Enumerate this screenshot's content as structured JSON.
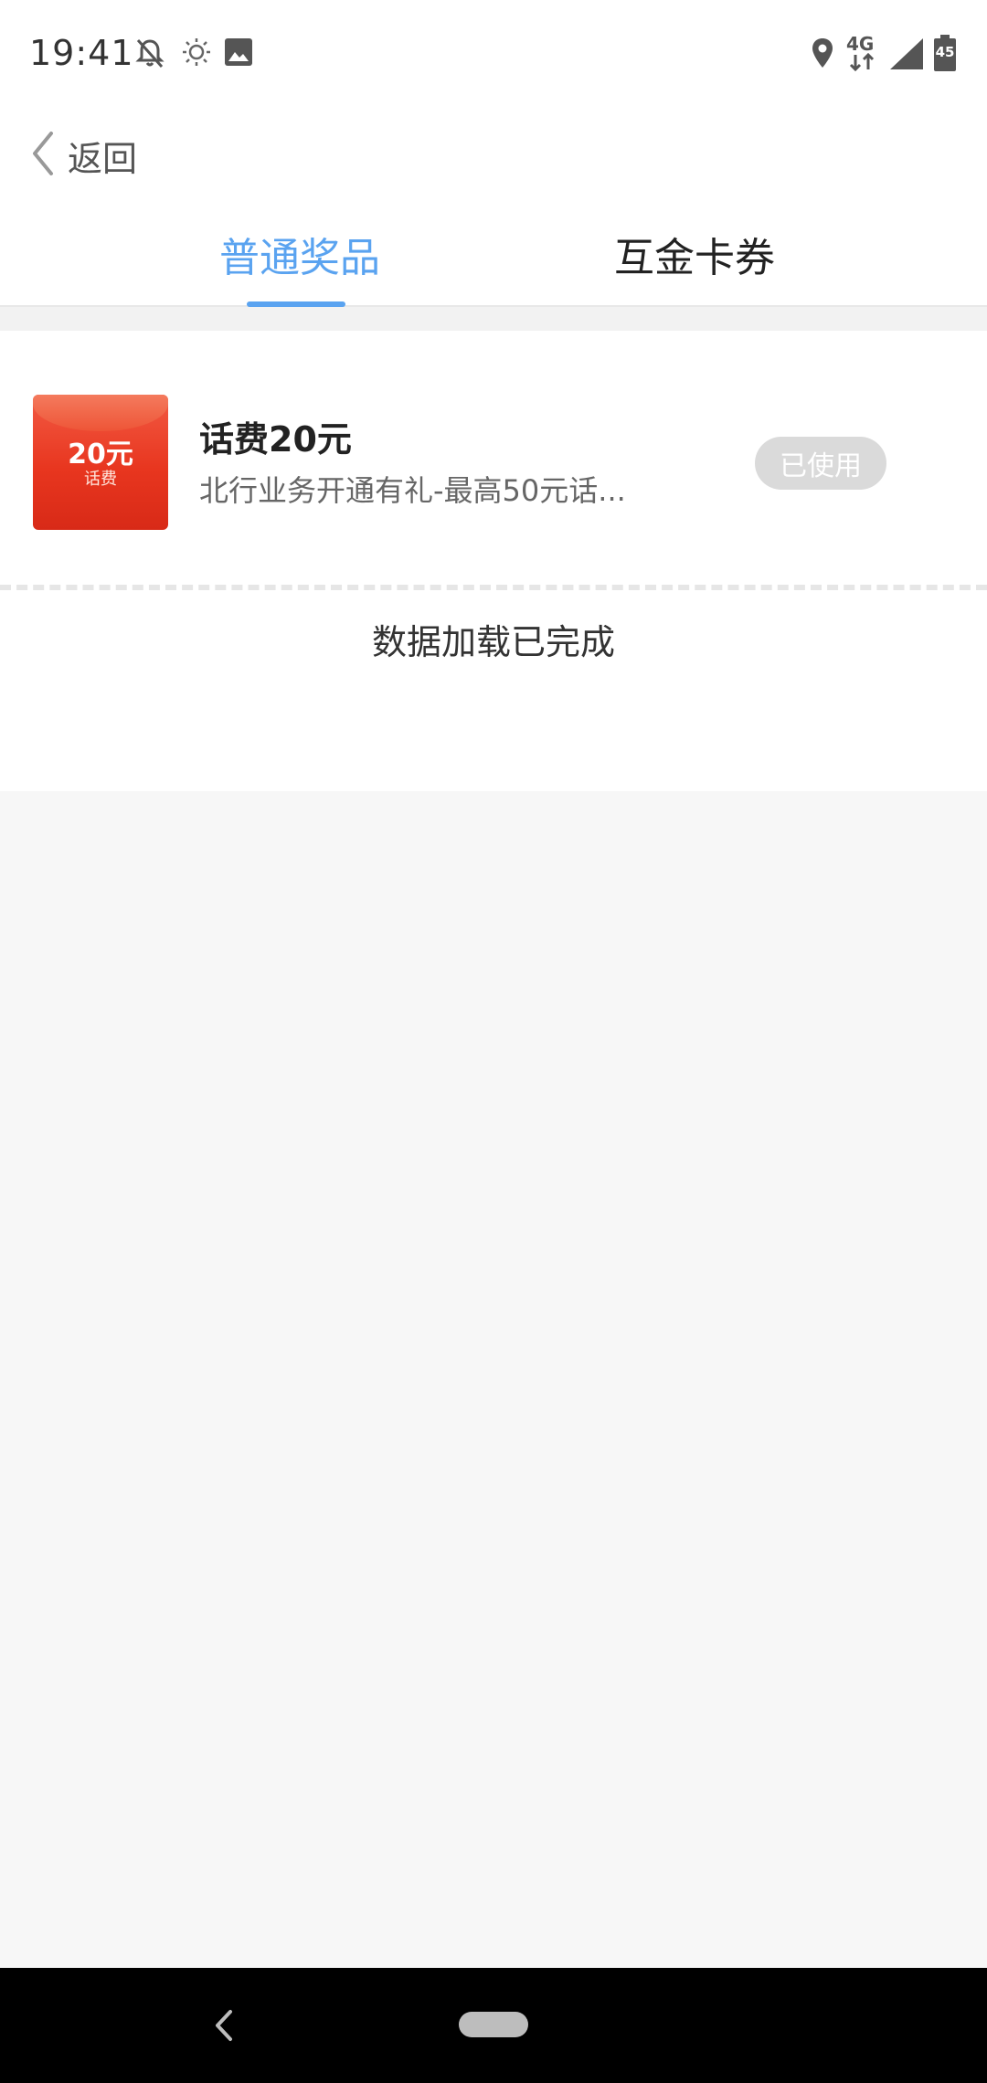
{
  "status_bar": {
    "time": "19:41",
    "icons": [
      "bell-off-icon",
      "brightness-icon",
      "image-icon",
      "location-icon",
      "network-4g-icon",
      "signal-icon",
      "battery-icon"
    ],
    "network_label": "4G",
    "battery_level": "45"
  },
  "header": {
    "back_label": "返回"
  },
  "tabs": [
    {
      "label": "普通奖品",
      "active": true
    },
    {
      "label": "互金卡券",
      "active": false
    }
  ],
  "prizes": [
    {
      "thumb_amount": "20元",
      "thumb_sub": "话费",
      "title": "话费20元",
      "description": "北行业务开通有礼-最高50元话...",
      "status": "已使用"
    }
  ],
  "list_footer": "数据加载已完成",
  "colors": {
    "accent": "#5aa3f0",
    "badge_bg": "#dadada",
    "red_packet": "#e8361f"
  }
}
